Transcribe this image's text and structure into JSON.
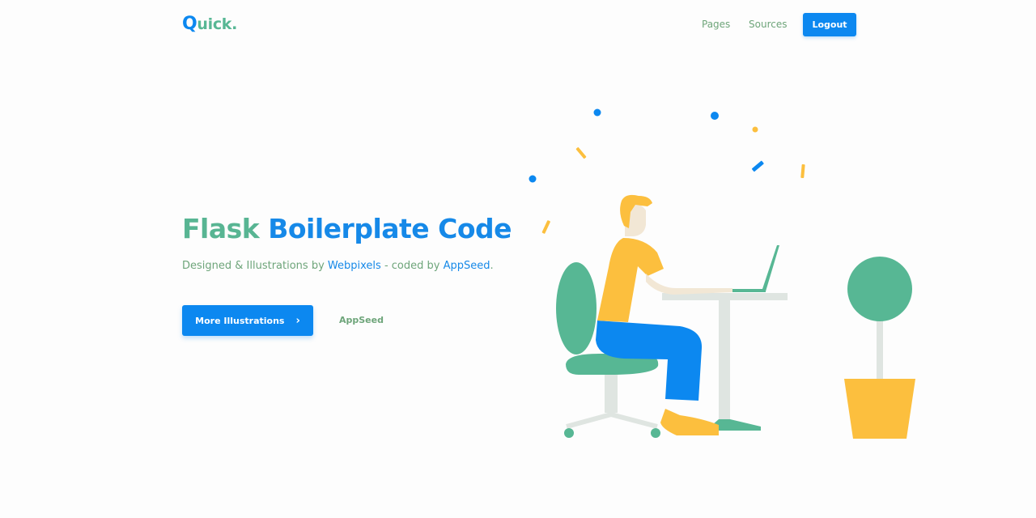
{
  "navbar": {
    "brand_q": "Q",
    "brand_rest": "uick.",
    "links": [
      "Pages",
      "Sources"
    ],
    "logout_label": "Logout"
  },
  "hero": {
    "title_part1": "Flask",
    "title_part2": "Boilerplate Code",
    "subtitle_prefix": "Designed & Illustrations by",
    "subtitle_link1": "Webpixels",
    "subtitle_middle": "- coded by",
    "subtitle_link2": "AppSeed",
    "subtitle_suffix": ".",
    "primary_button": "More Illustrations",
    "secondary_link": "AppSeed"
  },
  "colors": {
    "primary_blue": "#0c88f0",
    "green": "#57b794",
    "link_green": "#6ea57a",
    "yellow": "#fcbf3e"
  }
}
